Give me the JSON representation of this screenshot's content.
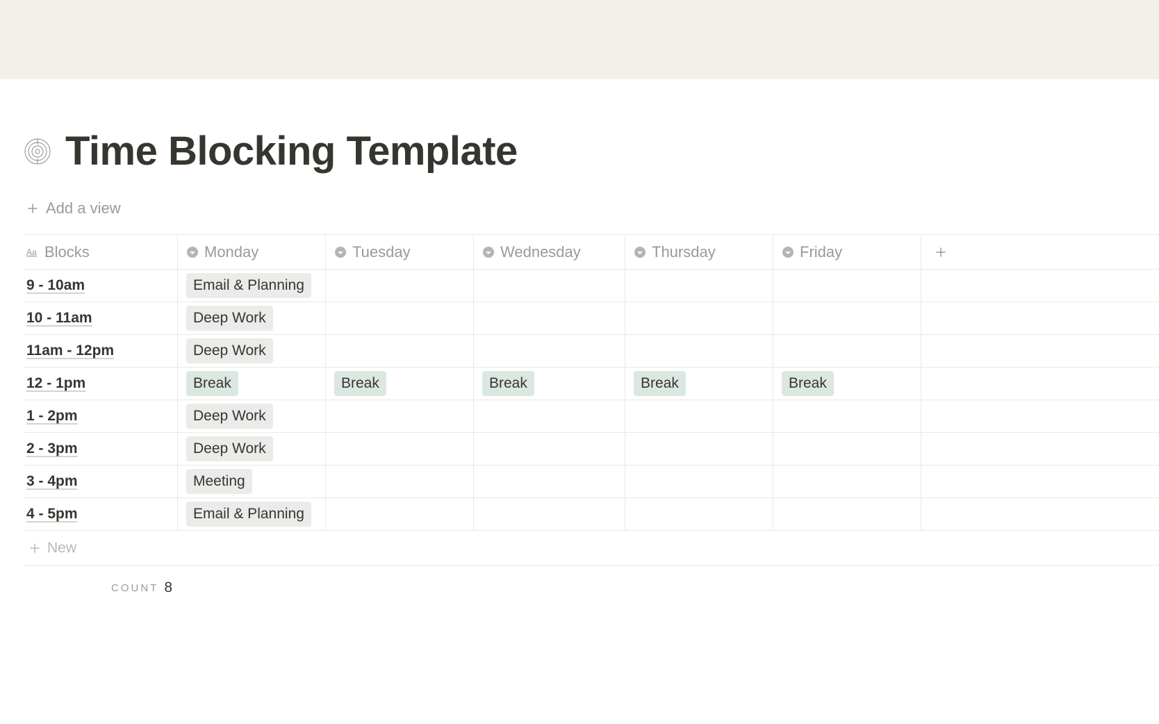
{
  "header": {
    "title": "Time Blocking Template",
    "add_view_label": "Add a view"
  },
  "table": {
    "columns": [
      {
        "label": "Blocks",
        "icon": "text"
      },
      {
        "label": "Monday",
        "icon": "select"
      },
      {
        "label": "Tuesday",
        "icon": "select"
      },
      {
        "label": "Wednesday",
        "icon": "select"
      },
      {
        "label": "Thursday",
        "icon": "select"
      },
      {
        "label": "Friday",
        "icon": "select"
      }
    ],
    "rows": [
      {
        "block": "9 - 10am",
        "cells": [
          {
            "label": "Email & Planning",
            "color": "gray"
          },
          null,
          null,
          null,
          null
        ]
      },
      {
        "block": "10 - 11am",
        "cells": [
          {
            "label": "Deep Work",
            "color": "gray"
          },
          null,
          null,
          null,
          null
        ]
      },
      {
        "block": "11am - 12pm",
        "cells": [
          {
            "label": "Deep Work",
            "color": "gray"
          },
          null,
          null,
          null,
          null
        ]
      },
      {
        "block": "12 - 1pm",
        "cells": [
          {
            "label": "Break",
            "color": "green"
          },
          {
            "label": "Break",
            "color": "green"
          },
          {
            "label": "Break",
            "color": "green"
          },
          {
            "label": "Break",
            "color": "green"
          },
          {
            "label": "Break",
            "color": "green"
          }
        ]
      },
      {
        "block": "1 - 2pm",
        "cells": [
          {
            "label": "Deep Work",
            "color": "gray"
          },
          null,
          null,
          null,
          null
        ]
      },
      {
        "block": "2 - 3pm",
        "cells": [
          {
            "label": "Deep Work",
            "color": "gray"
          },
          null,
          null,
          null,
          null
        ]
      },
      {
        "block": "3 - 4pm",
        "cells": [
          {
            "label": "Meeting",
            "color": "gray"
          },
          null,
          null,
          null,
          null
        ]
      },
      {
        "block": "4 - 5pm",
        "cells": [
          {
            "label": "Email & Planning",
            "color": "gray"
          },
          null,
          null,
          null,
          null
        ]
      }
    ],
    "new_label": "New",
    "count_label": "COUNT",
    "count_value": "8"
  }
}
